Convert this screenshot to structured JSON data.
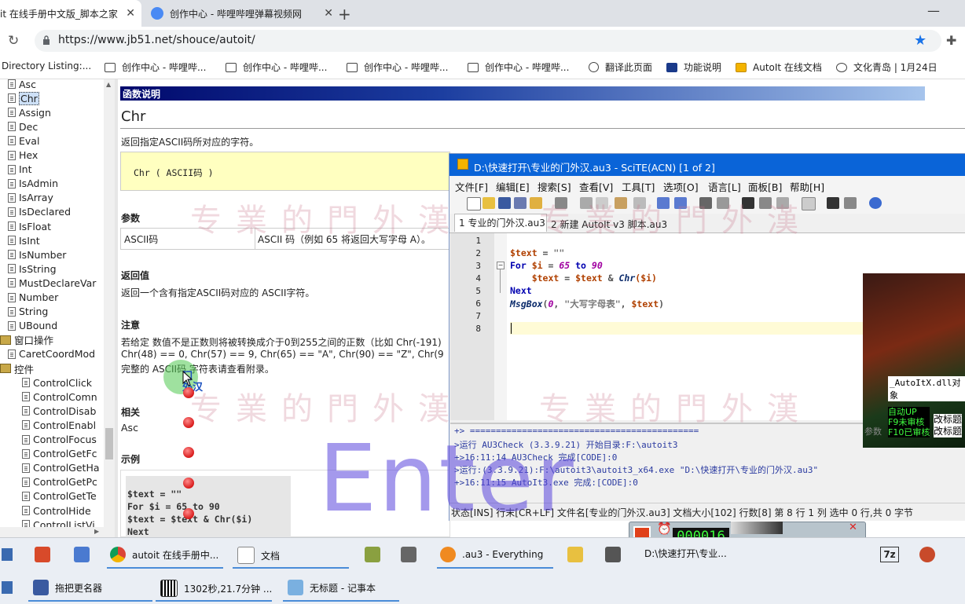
{
  "browser": {
    "tabs": [
      {
        "label": "it 在线手册中文版_脚本之家",
        "active": true
      },
      {
        "label": "创作中心 - 哔哩哔哩弹幕视频网",
        "active": false
      }
    ],
    "new_tab": "+",
    "window_controls": {
      "minimize": "—",
      "close": "✕"
    },
    "url": "https://www.jb51.net/shouce/autoit/",
    "bookmarks": [
      "Directory Listing:...",
      "创作中心 - 哔哩哔...",
      "创作中心 - 哔哩哔...",
      "创作中心 - 哔哩哔...",
      "创作中心 - 哔哩哔...",
      "翻译此页面",
      "功能说明",
      "AutoIt 在线文档",
      "文化青岛 | 1月24日"
    ]
  },
  "tree": {
    "items": [
      {
        "label": "Asc",
        "level": 1
      },
      {
        "label": "Chr",
        "level": 1,
        "selected": true
      },
      {
        "label": "Assign",
        "level": 1
      },
      {
        "label": "Dec",
        "level": 1
      },
      {
        "label": "Eval",
        "level": 1
      },
      {
        "label": "Hex",
        "level": 1
      },
      {
        "label": "Int",
        "level": 1
      },
      {
        "label": "IsAdmin",
        "level": 1
      },
      {
        "label": "IsArray",
        "level": 1
      },
      {
        "label": "IsDeclared",
        "level": 1
      },
      {
        "label": "IsFloat",
        "level": 1
      },
      {
        "label": "IsInt",
        "level": 1
      },
      {
        "label": "IsNumber",
        "level": 1
      },
      {
        "label": "IsString",
        "level": 1
      },
      {
        "label": "MustDeclareVar",
        "level": 1
      },
      {
        "label": "Number",
        "level": 1
      },
      {
        "label": "String",
        "level": 1
      },
      {
        "label": "UBound",
        "level": 1
      },
      {
        "label": "窗口操作",
        "level": 0,
        "book": true
      },
      {
        "label": "CaretCoordMod",
        "level": 1
      },
      {
        "label": "控件",
        "level": 0,
        "book": true
      },
      {
        "label": "ControlClick",
        "level": 2
      },
      {
        "label": "ControlComn",
        "level": 2
      },
      {
        "label": "ControlDisab",
        "level": 2
      },
      {
        "label": "ControlEnabl",
        "level": 2
      },
      {
        "label": "ControlFocus",
        "level": 2
      },
      {
        "label": "ControlGetFc",
        "level": 2
      },
      {
        "label": "ControlGetHa",
        "level": 2
      },
      {
        "label": "ControlGetPc",
        "level": 2
      },
      {
        "label": "ControlGetTe",
        "level": 2
      },
      {
        "label": "ControlHide",
        "level": 2
      },
      {
        "label": "ControlListVi",
        "level": 2
      }
    ]
  },
  "doc": {
    "band_title": "函数说明",
    "heading": "Chr",
    "description": "返回指定ASCII码所对应的字符。",
    "syntax": "Chr ( ASCII码 )",
    "params_title": "参数",
    "param_name": "ASCII码",
    "param_desc": "ASCII 码（例如 65 将返回大写字母 A）。",
    "return_title": "返回值",
    "return_desc": "返回一个含有指定ASCII码对应的 ASCII字符。",
    "note_title": "注意",
    "note_line1": "若给定 数值不是正数则将被转换成介于0到255之间的正数（比如 Chr(-191)",
    "note_line2": "Chr(48) == 0, Chr(57) == 9, Chr(65) == \"A\", Chr(90) == \"Z\", Chr(9",
    "note_line3": "完整的 ASCII码 字符表请查看附录。",
    "related_title": "相关",
    "related_item": "Asc",
    "example_title": "示例",
    "example_lines": [
      "$text = \"\"",
      "For $i = 65 to 90",
      "    $text = $text & Chr($i)",
      "Next"
    ],
    "cursor_label_1": "门",
    "cursor_label_2": "外汉"
  },
  "watermark": {
    "seal_text": "专業的門外漢",
    "enter_text": "Enter"
  },
  "scite": {
    "title": "D:\\快速打开\\专业的门外汉.au3 - SciTE(ACN) [1 of 2]",
    "menu": [
      "文件[F]",
      "编辑[E]",
      "搜索[S]",
      "查看[V]",
      "工具[T]",
      "选项[O]",
      "语言[L]",
      "面板[B]",
      "帮助[H]"
    ],
    "tabs": [
      "1 专业的门外汉.au3",
      "2 新建 AutoIt v3 脚本.au3"
    ],
    "line_numbers": [
      "1",
      "2",
      "3",
      "4",
      "5",
      "6",
      "7",
      "8"
    ],
    "code": {
      "l2_var": "$text",
      "l2_rest": " = ",
      "l2_str": "\"\"",
      "l3_kw1": "For",
      "l3_var": " $i",
      "l3_eq": " = ",
      "l3_n1": "65",
      "l3_kw2": " to ",
      "l3_n2": "90",
      "l4_var1": "    $text",
      "l4_eq": " = ",
      "l4_var2": "$text",
      "l4_amp": " & ",
      "l4_fn": "Chr",
      "l4_arg": "($i)",
      "l5_kw": "Next",
      "l6_fn": "MsgBox",
      "l6_p1": "(",
      "l6_n": "0",
      "l6_c1": ", ",
      "l6_str": "\"大写字母表\"",
      "l6_c2": ", ",
      "l6_var": "$text",
      "l6_p2": ")"
    },
    "output": [
      "+> ============================================",
      ">运行 AU3Check (3.3.9.21)  开始目录:F:\\autoit3",
      "+>16:11:14 AU3Check 完成[CODE]:0",
      ">运行:(3.3.9.21):F:\\autoit3\\autoit3_x64.exe \"D:\\快速打开\\专业的门外汉.au3\"",
      "+>16:11:15 AutoIt3.exe 完成:[CODE]:0"
    ],
    "status": "状态[INS] 行末[CR+LF] 文件名[专业的门外汉.au3] 文档大小[102] 行数[8] 第 8 行 1 列 选中 0 行,共 0 字节"
  },
  "overlay": {
    "video_label": "_AutoItX.dll对象",
    "green_lines": [
      "自动UP",
      "F9未审核",
      "F10已审核"
    ],
    "side_lines": [
      "改标题",
      "改标题"
    ],
    "side_param": "参数",
    "rec_time": "000016"
  },
  "taskbar": {
    "row1": [
      "autoit 在线手册中...",
      "文档",
      ".au3 - Everything",
      "D:\\快速打开\\专业..."
    ],
    "row2": [
      "拖把更名器",
      "1302秒,21.7分钟 ...",
      "无标题 - 记事本"
    ],
    "seven_z": "7z"
  }
}
